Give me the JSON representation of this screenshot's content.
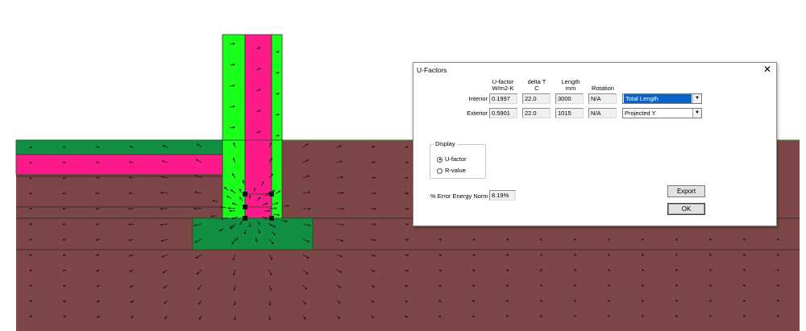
{
  "dialog": {
    "title": "U-Factors",
    "close_glyph": "✕",
    "columns": {
      "ufactor": "U-factor",
      "ufactor_unit": "W/m2-K",
      "delta_t": "delta T",
      "delta_t_unit": "C",
      "length": "Length",
      "length_unit": "mm",
      "rotation": "Rotation"
    },
    "rows": [
      {
        "label": "Interior",
        "ufactor": "0.1997",
        "delta_t": "22.0",
        "length": "3000",
        "rotation": "N/A",
        "select": "Total Length"
      },
      {
        "label": "Exterior",
        "ufactor": "0.5901",
        "delta_t": "22.0",
        "length": "1015",
        "rotation": "N/A",
        "select": "Projected Y"
      }
    ],
    "display_group": {
      "legend": "Display",
      "options": [
        "U-factor",
        "R-value"
      ],
      "selected": "U-factor"
    },
    "error_label": "% Error Energy Norm",
    "error_value": "8.19%",
    "export_button": "Export",
    "ok_button": "OK"
  },
  "colors": {
    "soil": "#7d4747",
    "magenta": "#ff1a8c",
    "green_light": "#1aff1a",
    "green_dark": "#119043",
    "select_highlight": "#0a64c8"
  },
  "icons": {
    "close": "close-icon",
    "dropdown": "chevron-down-icon",
    "radio": "radio-icon"
  }
}
